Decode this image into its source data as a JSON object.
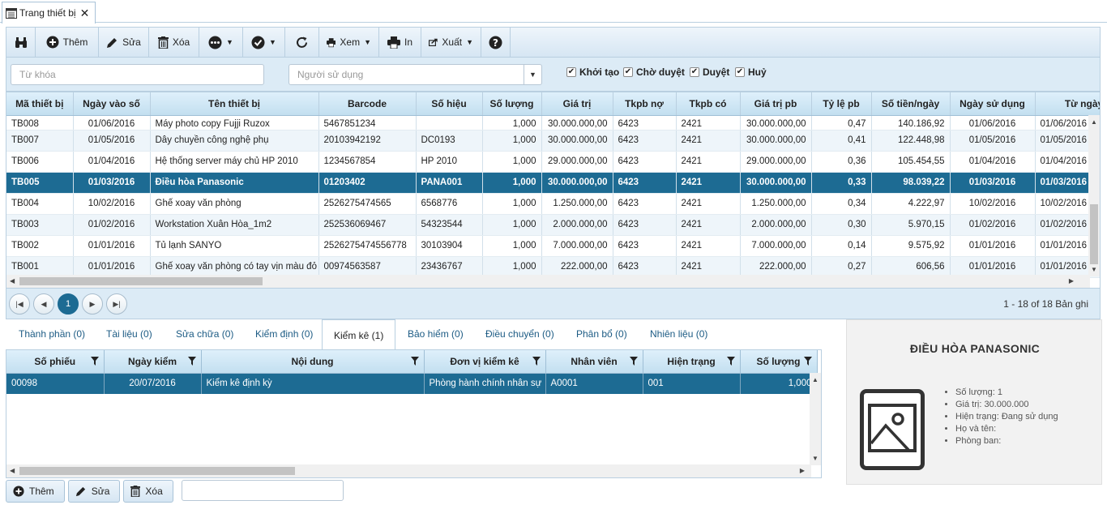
{
  "tab": {
    "title": "Trang thiết bị"
  },
  "toolbar": {
    "add": "Thêm",
    "edit": "Sửa",
    "delete": "Xóa",
    "view": "Xem",
    "print": "In",
    "export": "Xuất"
  },
  "filter": {
    "keyword_placeholder": "Từ khóa",
    "user_placeholder": "Người sử dụng",
    "checks": [
      {
        "label": "Khởi tạo",
        "checked": true
      },
      {
        "label": "Chờ duyệt",
        "checked": true
      },
      {
        "label": "Duyệt",
        "checked": true
      },
      {
        "label": "Huỷ",
        "checked": true
      }
    ]
  },
  "grid": {
    "columns": [
      "Mã thiết bị",
      "Ngày vào số",
      "Tên thiết bị",
      "Barcode",
      "Số hiệu",
      "Số lượng",
      "Giá trị",
      "Tkpb nợ",
      "Tkpb có",
      "Giá trị pb",
      "Tỷ lệ pb",
      "Số tiền/ngày",
      "Ngày sử dụng",
      "Từ ngày"
    ],
    "rows": [
      [
        "TB008",
        "01/06/2016",
        "Máy photo copy Fujji Ruzox",
        "5467851234",
        "",
        "1,000",
        "30.000.000,00",
        "6423",
        "2421",
        "30.000.000,00",
        "0,47",
        "140.186,92",
        "01/06/2016",
        "01/06/2016"
      ],
      [
        "TB007",
        "01/05/2016",
        "Dây chuyền công nghệ phụ",
        "20103942192",
        "DC0193",
        "1,000",
        "30.000.000,00",
        "6423",
        "2421",
        "30.000.000,00",
        "0,41",
        "122.448,98",
        "01/05/2016",
        "01/05/2016"
      ],
      [
        "TB006",
        "01/04/2016",
        "Hệ thống server máy chủ HP 2010",
        "1234567854",
        "HP 2010",
        "1,000",
        "29.000.000,00",
        "6423",
        "2421",
        "29.000.000,00",
        "0,36",
        "105.454,55",
        "01/04/2016",
        "01/04/2016"
      ],
      [
        "TB005",
        "01/03/2016",
        "Điều hòa Panasonic",
        "01203402",
        "PANA001",
        "1,000",
        "30.000.000,00",
        "6423",
        "2421",
        "30.000.000,00",
        "0,33",
        "98.039,22",
        "01/03/2016",
        "01/03/2016"
      ],
      [
        "TB004",
        "10/02/2016",
        "Ghế xoay văn phòng",
        "2526275474565",
        "6568776",
        "1,000",
        "1.250.000,00",
        "6423",
        "2421",
        "1.250.000,00",
        "0,34",
        "4.222,97",
        "10/02/2016",
        "10/02/2016"
      ],
      [
        "TB003",
        "01/02/2016",
        "Workstation Xuân Hòa_1m2",
        "252536069467",
        "54323544",
        "1,000",
        "2.000.000,00",
        "6423",
        "2421",
        "2.000.000,00",
        "0,30",
        "5.970,15",
        "01/02/2016",
        "01/02/2016"
      ],
      [
        "TB002",
        "01/01/2016",
        "Tủ lạnh SANYO",
        "2526275474556778",
        "30103904",
        "1,000",
        "7.000.000,00",
        "6423",
        "2421",
        "7.000.000,00",
        "0,14",
        "9.575,92",
        "01/01/2016",
        "01/01/2016"
      ],
      [
        "TB001",
        "01/01/2016",
        "Ghế xoay văn phòng có tay vịn màu đỏ",
        "00974563587",
        "23436767",
        "1,000",
        "222.000,00",
        "6423",
        "2421",
        "222.000,00",
        "0,27",
        "606,56",
        "01/01/2016",
        "01/01/2016"
      ]
    ],
    "selected_index": 3
  },
  "pager": {
    "current": "1",
    "info": "1 - 18 of 18 Bản ghi"
  },
  "subtabs": [
    "Thành phần (0)",
    "Tài liệu (0)",
    "Sửa chữa (0)",
    "Kiểm định (0)",
    "Kiểm kê (1)",
    "Bảo hiểm (0)",
    "Điều chuyển (0)",
    "Phân bổ (0)",
    "Nhiên liệu (0)"
  ],
  "active_subtab": 4,
  "inventory": {
    "columns": [
      "Số phiếu",
      "Ngày kiểm",
      "Nội dung",
      "Đơn vị kiểm kê",
      "Nhân viên",
      "Hiện trạng",
      "Số lượng"
    ],
    "rows": [
      [
        "00098",
        "20/07/2016",
        "Kiểm kê định kỳ",
        "Phòng hành chính nhân sự",
        "A0001",
        "001",
        "1,000"
      ]
    ]
  },
  "bottom": {
    "add": "Thêm",
    "edit": "Sửa",
    "delete": "Xóa"
  },
  "detail": {
    "title": "ĐIỀU HÒA PANASONIC",
    "items": [
      "Số lượng: 1",
      "Giá trị: 30.000.000",
      "Hiện trạng: Đang sử dụng",
      "Họ và tên:",
      "Phòng ban:"
    ]
  },
  "colors": {
    "accent": "#1d6b93",
    "header_bg": "#c3dff0",
    "alt_row": "#eef5fa"
  }
}
